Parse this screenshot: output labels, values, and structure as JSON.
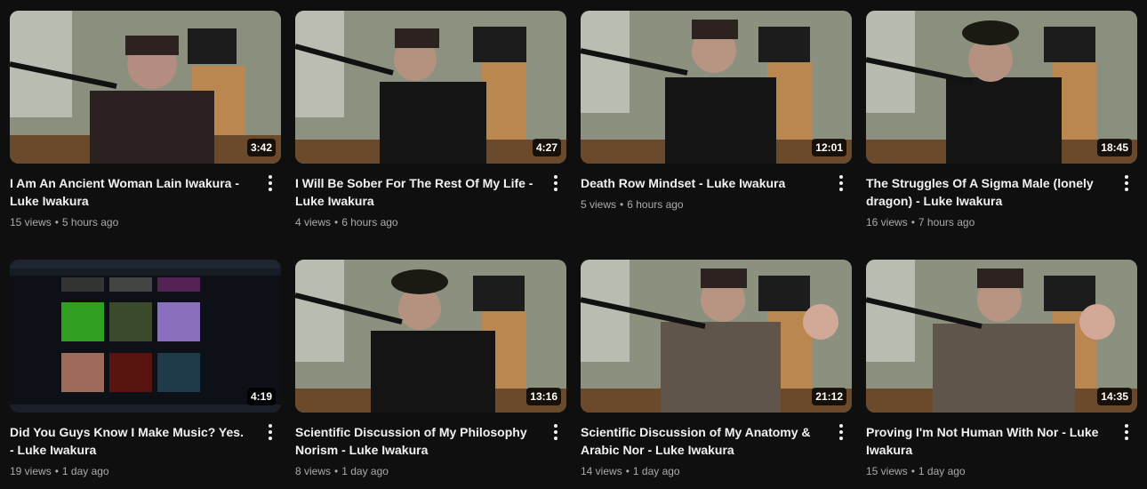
{
  "videos": [
    {
      "title": "I Am An Ancient Woman Lain Iwakura - Luke Iwakura",
      "views": "15 views",
      "age": "5 hours ago",
      "duration": "3:42"
    },
    {
      "title": "I Will Be Sober For The Rest Of My Life - Luke Iwakura",
      "views": "4 views",
      "age": "6 hours ago",
      "duration": "4:27"
    },
    {
      "title": "Death Row Mindset - Luke Iwakura",
      "views": "5 views",
      "age": "6 hours ago",
      "duration": "12:01"
    },
    {
      "title": "The Struggles Of A Sigma Male (lonely dragon) - Luke Iwakura",
      "views": "16 views",
      "age": "7 hours ago",
      "duration": "18:45"
    },
    {
      "title": "Did You Guys Know I Make Music? Yes. - Luke Iwakura",
      "views": "19 views",
      "age": "1 day ago",
      "duration": "4:19"
    },
    {
      "title": "Scientific Discussion of My Philosophy Norism - Luke Iwakura",
      "views": "8 views",
      "age": "1 day ago",
      "duration": "13:16"
    },
    {
      "title": "Scientific Discussion of My Anatomy & Arabic Nor - Luke Iwakura",
      "views": "14 views",
      "age": "1 day ago",
      "duration": "21:12"
    },
    {
      "title": "Proving I'm Not Human With Nor - Luke Iwakura",
      "views": "15 views",
      "age": "1 day ago",
      "duration": "14:35"
    }
  ],
  "separator": "•"
}
